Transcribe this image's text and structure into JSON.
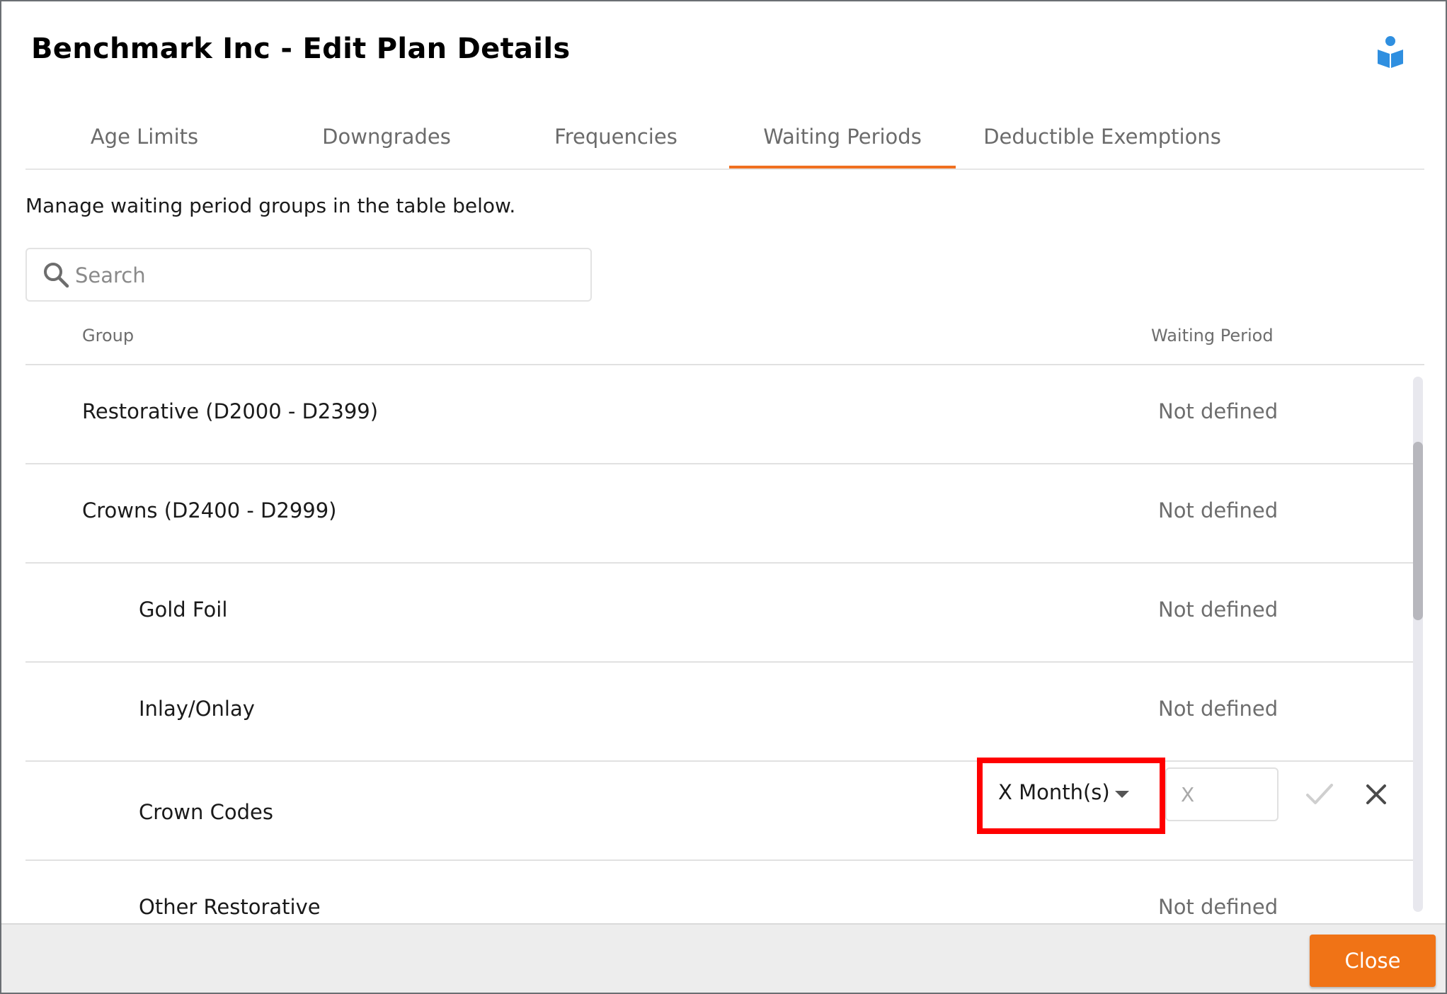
{
  "dialog": {
    "title": "Benchmark Inc - Edit Plan Details",
    "help_icon": "book-reader-icon"
  },
  "tabs": [
    {
      "label": "Age Limits",
      "active": false
    },
    {
      "label": "Downgrades",
      "active": false
    },
    {
      "label": "Frequencies",
      "active": false
    },
    {
      "label": "Waiting Periods",
      "active": true
    },
    {
      "label": "Deductible Exemptions",
      "active": false
    }
  ],
  "intro_text": "Manage waiting period groups in the table below.",
  "search": {
    "placeholder": "Search",
    "value": "",
    "icon": "search-icon"
  },
  "table": {
    "columns": {
      "group": "Group",
      "waiting_period": "Waiting Period"
    },
    "rows": [
      {
        "group": "Restorative (D2000 - D2399)",
        "waiting_period": "Not defined",
        "level": 0
      },
      {
        "group": "Crowns (D2400 - D2999)",
        "waiting_period": "Not defined",
        "level": 0
      },
      {
        "group": "Gold Foil",
        "waiting_period": "Not defined",
        "level": 1
      },
      {
        "group": "Inlay/Onlay",
        "waiting_period": "Not defined",
        "level": 1
      },
      {
        "group": "Crown Codes",
        "waiting_period": "",
        "level": 1,
        "editing": true
      },
      {
        "group": "Other Restorative",
        "waiting_period": "Not defined",
        "level": 1
      }
    ]
  },
  "editor": {
    "unit_select_value": "X Month(s)",
    "count_placeholder": "X",
    "count_value": "",
    "confirm_icon": "check-icon",
    "cancel_icon": "close-icon"
  },
  "footer": {
    "close_label": "Close"
  },
  "colors": {
    "accent": "#f07020",
    "highlight": "#ff0000",
    "help_icon": "#2f8fe0"
  }
}
